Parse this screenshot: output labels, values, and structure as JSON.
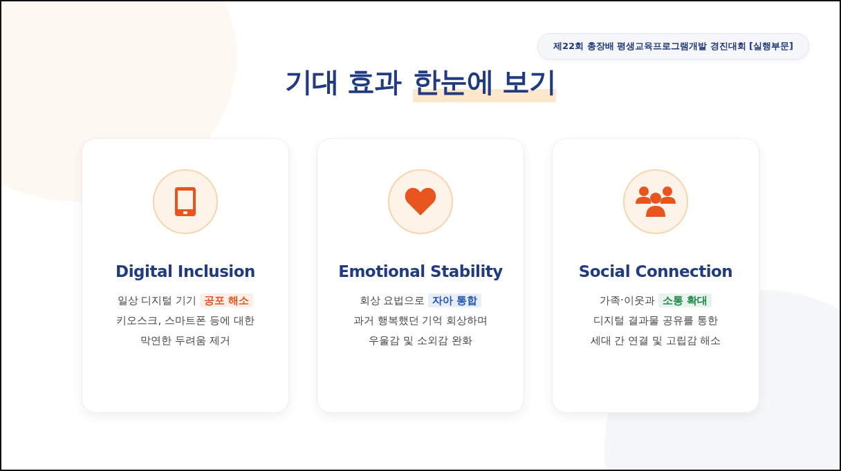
{
  "badge": "제22회 총장배 평생교육프로그램개발 경진대회 [실행부문]",
  "heading": {
    "plain": "기대 효과",
    "highlight": "한눈에 보기"
  },
  "cards": [
    {
      "title": "Digital Inclusion",
      "lead": "일상 디지털 기기",
      "highlight": "공포 해소",
      "color": "#e8541e",
      "lines": [
        "키오스크, 스마트폰 등에 대한",
        "막연한 두려움 제거"
      ]
    },
    {
      "title": "Emotional Stability",
      "lead": "회상 요법으로",
      "highlight": "자아 통합",
      "color": "#2255b5",
      "lines": [
        "과거 행복했던 기억 회상하며",
        "우울감 및 소외감 완화"
      ]
    },
    {
      "title": "Social Connection",
      "lead": "가족·이웃과",
      "highlight": "소통 확대",
      "color": "#1e8a4a",
      "lines": [
        "디지털 결과물 공유를 통한",
        "세대 간 연결 및 고립감 해소"
      ]
    }
  ]
}
